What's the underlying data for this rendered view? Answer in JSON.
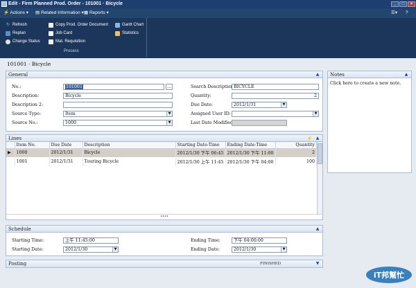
{
  "window": {
    "title": "Edit - Firm Planned Prod. Order - 101001 · Bicycle",
    "controls": [
      "_",
      "□",
      "×"
    ]
  },
  "menubar": {
    "actions": "Actions",
    "related": "Related Information",
    "reports": "Reports"
  },
  "ribbon": {
    "buttons": {
      "refresh": "Refresh",
      "replan": "Replan",
      "change_status": "Change Status",
      "copy_doc": "Copy Prod. Order Document",
      "job_card": "Job Card",
      "mat_req": "Mat. Requisition",
      "gantt": "Gantt Chart",
      "statistics": "Statistics"
    },
    "group_label": "Process"
  },
  "record": {
    "header": "101001 · Bicycle"
  },
  "general": {
    "title": "General",
    "no_label": "No.:",
    "no_value": "101001",
    "description_label": "Description:",
    "description_value": "Bicycle",
    "description2_label": "Description 2:",
    "description2_value": "",
    "source_type_label": "Source Type:",
    "source_type_value": "Item",
    "source_no_label": "Source No.:",
    "source_no_value": "1000",
    "search_desc_label": "Search Description:",
    "search_desc_value": "BICYCLE",
    "quantity_label": "Quantity:",
    "quantity_value": "2",
    "due_date_label": "Due Date:",
    "due_date_value": "2012/1/31",
    "assigned_user_label": "Assigned User ID:",
    "assigned_user_value": "",
    "last_modified_label": "Last Date Modified:",
    "last_modified_value": "",
    "ellipsis": "..."
  },
  "notes": {
    "title": "Notes",
    "placeholder": "Click here to create a new note."
  },
  "lines": {
    "title": "Lines",
    "columns": [
      "Item No.",
      "Due Date",
      "Description",
      "Starting Date-Time",
      "Ending Date-Time",
      "Quantity"
    ],
    "rows": [
      [
        "1000",
        "2012/1/31",
        "Bicycle",
        "2012/1/30 下午 06:45",
        "2012/1/30 下午 11:00",
        "2"
      ],
      [
        "1001",
        "2012/1/31",
        "Touring Bicycle",
        "2012/1/30 上午 11:45",
        "2012/1/30 下午 04:00",
        "100"
      ]
    ]
  },
  "schedule": {
    "title": "Schedule",
    "starting_time_label": "Starting Time:",
    "starting_time_value": "上午 11:45:00",
    "starting_date_label": "Starting Date:",
    "starting_date_value": "2012/1/30",
    "ending_time_label": "Ending Time:",
    "ending_time_value": "下午 04:00:00",
    "ending_date_label": "Ending Date:",
    "ending_date_value": "2012/1/30"
  },
  "posting": {
    "title": "Posting",
    "status": "FINISHED"
  },
  "watermark": {
    "text": "iT邦幫忙"
  },
  "colors": {
    "titlebar": "#1d3e6e",
    "ribbon": "#1c355a",
    "accent": "#3a5f96",
    "selected_row": "#d4d0c8"
  }
}
